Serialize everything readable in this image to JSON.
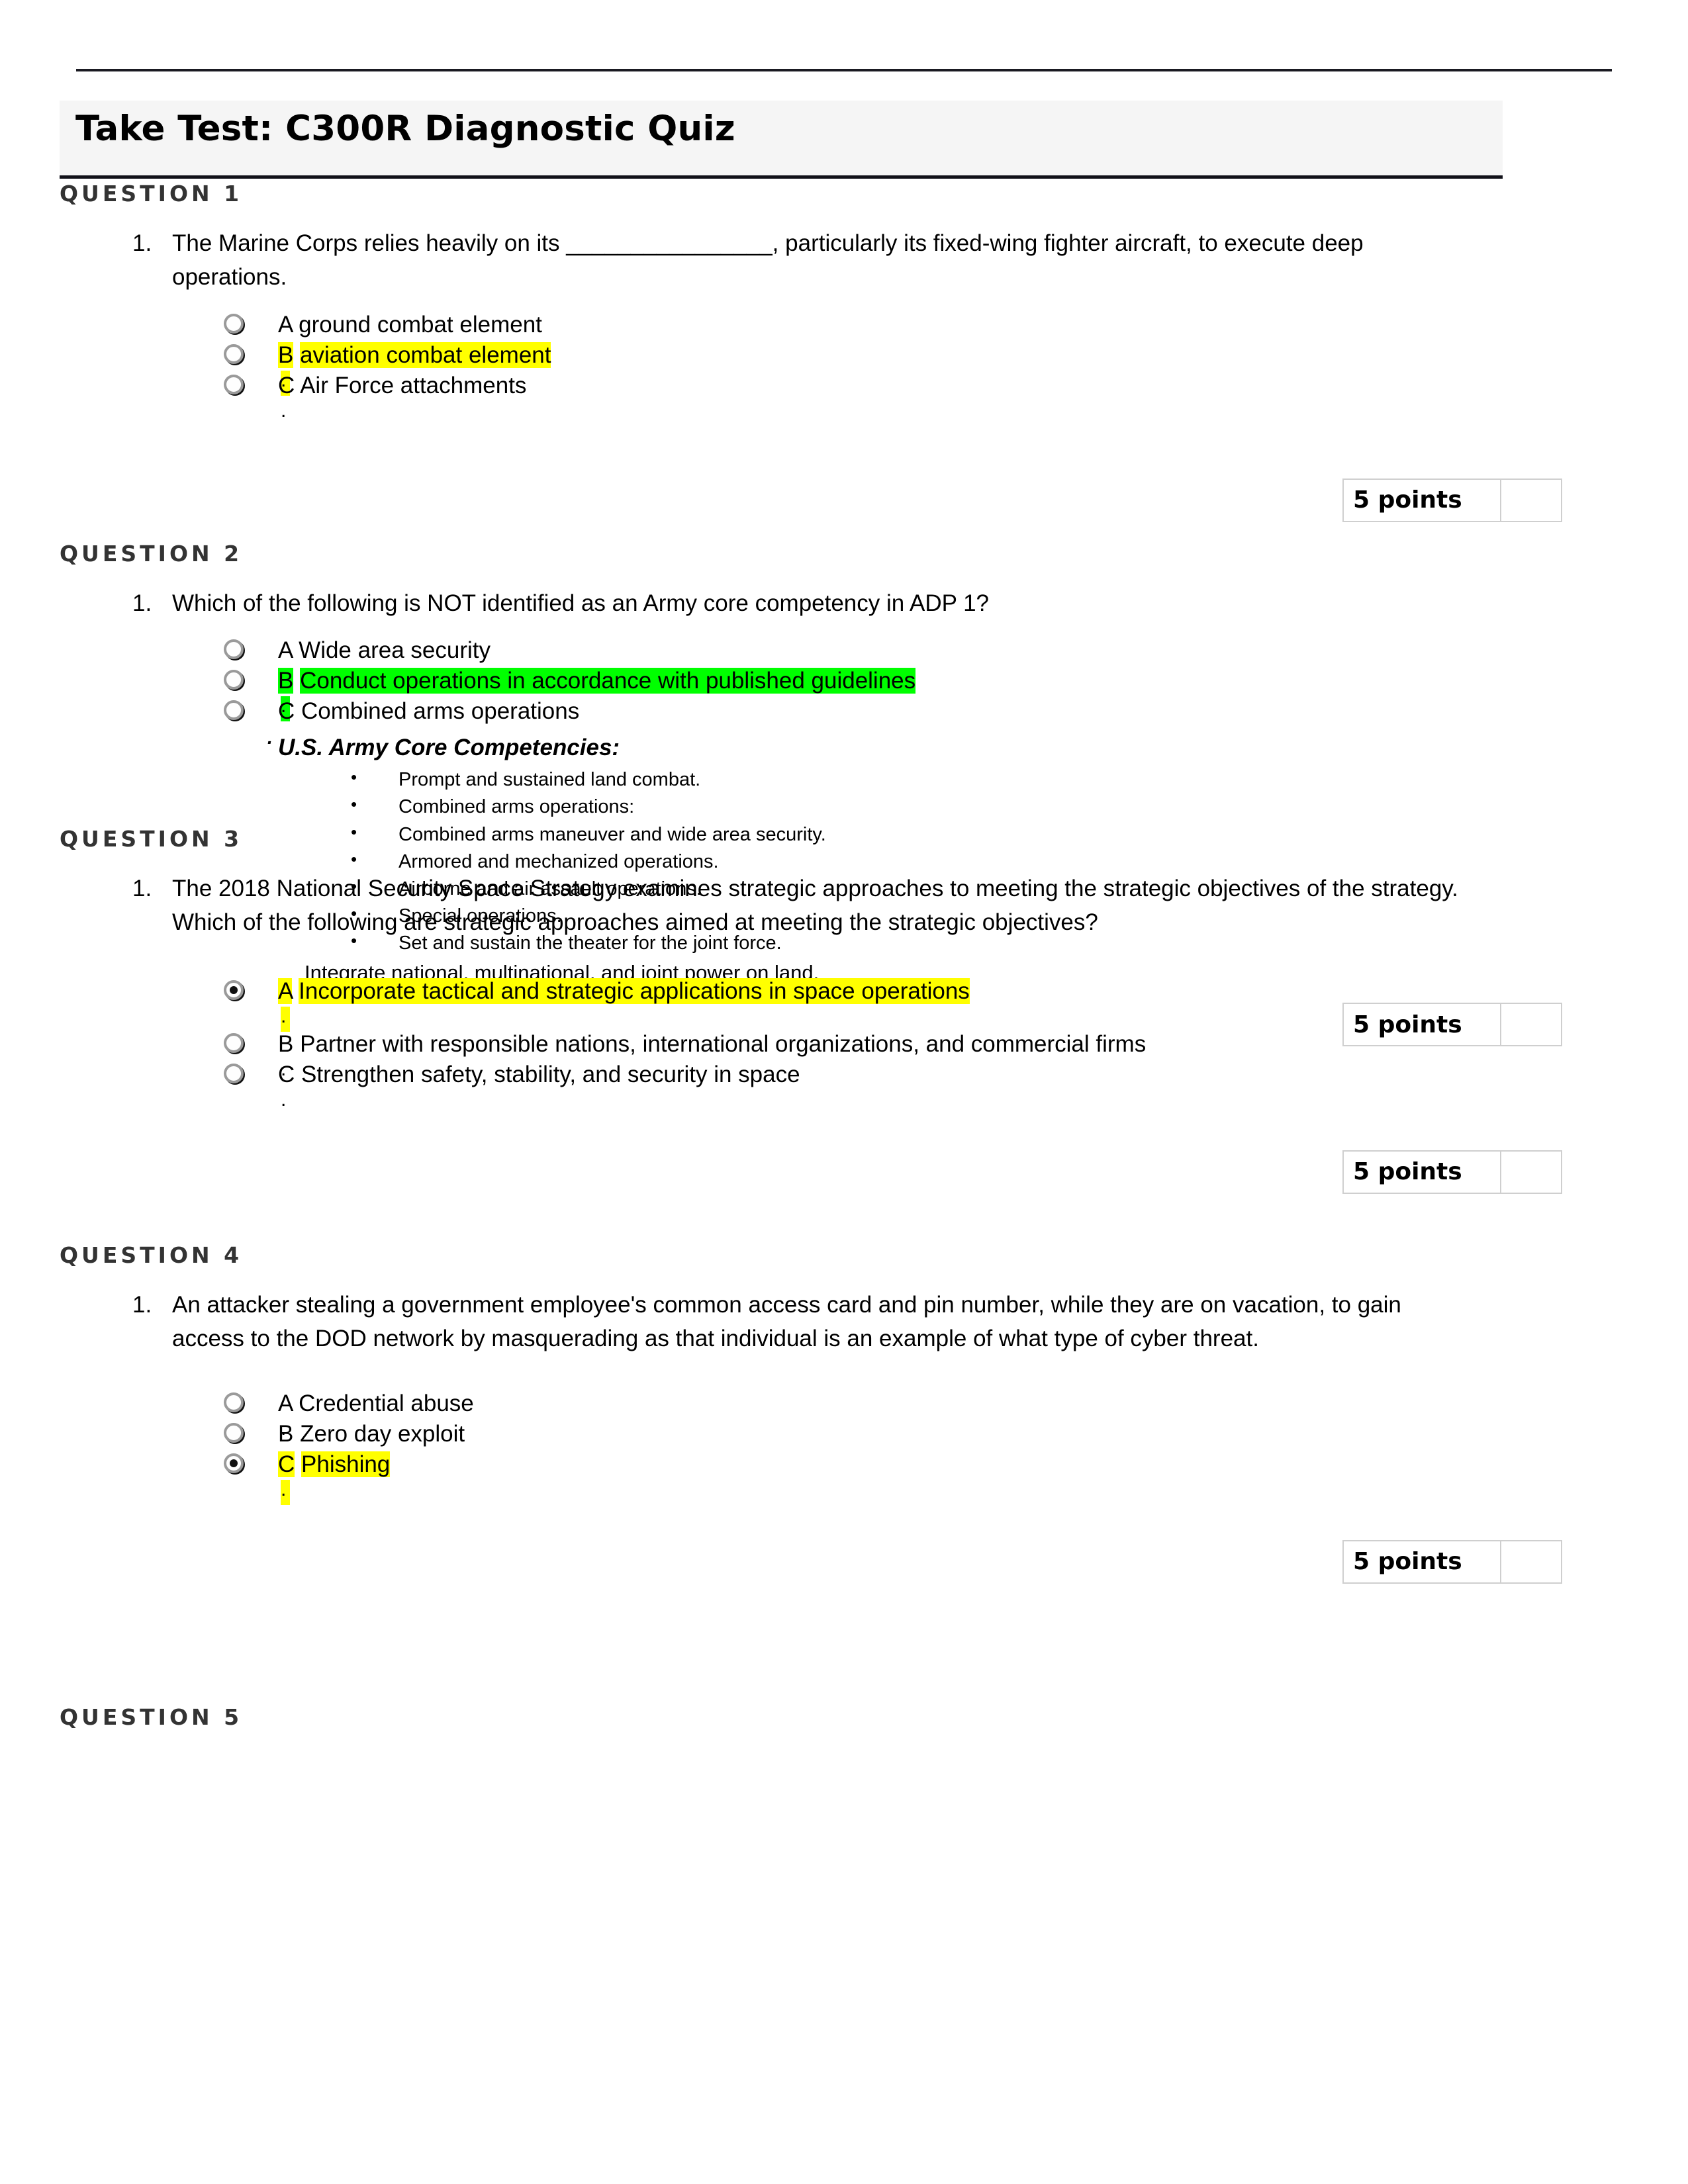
{
  "page": {
    "title": "Take Test: C300R Diagnostic Quiz"
  },
  "questions": [
    {
      "heading": "QUESTION 1",
      "number": "1.",
      "stem": "The Marine Corps relies heavily on its ________________, particularly its fixed-wing fighter aircraft, to execute deep operations.",
      "options": [
        {
          "letter": "A",
          "text": "ground combat element",
          "selected": false,
          "highlight": "none",
          "dot": "."
        },
        {
          "letter": "B",
          "text": "aviation combat element",
          "selected": false,
          "highlight": "yellow",
          "dot": "."
        },
        {
          "letter": "C",
          "text": "Air Force attachments",
          "selected": false,
          "highlight": "none",
          "dot": "."
        }
      ],
      "points": "5 points"
    },
    {
      "heading": "QUESTION 2",
      "number": "1.",
      "stem": "Which of the following is NOT identified as an Army core competency in ADP 1?",
      "options": [
        {
          "letter": "A",
          "text": "Wide area security",
          "selected": false,
          "highlight": "none",
          "dot": "."
        },
        {
          "letter": "B",
          "text": "Conduct operations in accordance with published guidelines",
          "selected": false,
          "highlight": "green",
          "dot": "."
        },
        {
          "letter": "C",
          "text": "Combined arms operations",
          "selected": false,
          "highlight": "none",
          "dot": ""
        }
      ],
      "competencies": {
        "lead_dot": "·",
        "title": "U.S. Army Core Competencies:",
        "items": [
          "Prompt and sustained land combat.",
          "Combined arms operations:",
          "Combined arms maneuver and wide area security.",
          "Armored and mechanized operations.",
          "Airborne and air assault operations.",
          "Special operations.",
          "Set and sustain the theater for the joint force."
        ],
        "tail": "Integrate national, multinational, and joint power on land."
      },
      "points": "5 points"
    },
    {
      "heading": "QUESTION 3",
      "number": "1.",
      "stem": "The 2018 National Security Space Strategy examines strategic approaches to meeting the strategic objectives of the strategy. Which of the following are strategic approaches aimed at meeting the strategic objectives?",
      "options": [
        {
          "letter": "A",
          "text": "Incorporate tactical and strategic applications in space operations",
          "selected": true,
          "highlight": "yellow",
          "dot": "."
        },
        {
          "letter": "B",
          "text": "Partner with responsible nations, international organizations, and commercial firms",
          "selected": false,
          "highlight": "none",
          "dot": "."
        },
        {
          "letter": "C",
          "text": "Strengthen safety, stability, and security in space",
          "selected": false,
          "highlight": "none",
          "dot": "."
        }
      ],
      "points": "5 points"
    },
    {
      "heading": "QUESTION 4",
      "number": "1.",
      "stem": "An attacker stealing a government employee's common access card and pin number, while they are on vacation, to gain access to the DOD network by masquerading as that individual is an example of what type of cyber threat.",
      "options": [
        {
          "letter": "A",
          "text": "Credential abuse",
          "selected": false,
          "highlight": "none",
          "dot": "."
        },
        {
          "letter": "B",
          "text": "Zero day exploit",
          "selected": false,
          "highlight": "none",
          "dot": "."
        },
        {
          "letter": "C",
          "text": "Phishing",
          "selected": true,
          "highlight": "yellow",
          "dot": "."
        }
      ],
      "points": "5 points"
    },
    {
      "heading": "QUESTION 5",
      "number": "",
      "stem": "",
      "options": [],
      "points": ""
    }
  ]
}
